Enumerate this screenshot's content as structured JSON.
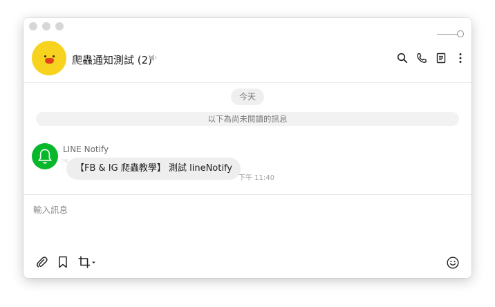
{
  "window": {
    "traffic_lights": [
      "close",
      "minimize",
      "zoom"
    ]
  },
  "header": {
    "chat_title": "爬蟲通知測試 (2)",
    "avatar_icon": "sally-chick-icon",
    "muted_icon": "speaker-icon",
    "actions": [
      {
        "icon": "search-icon"
      },
      {
        "icon": "phone-icon"
      },
      {
        "icon": "notes-icon"
      },
      {
        "icon": "more-vertical-icon"
      }
    ]
  },
  "chat": {
    "date_label": "今天",
    "unread_label": "以下為尚未閱讀的訊息",
    "messages": [
      {
        "sender": "LINE Notify",
        "text": "【FB & IG 爬蟲教學】 測試 lineNotify",
        "time": "下午 11:40",
        "avatar_icon": "bell-icon",
        "avatar_color": "#06b72b"
      }
    ]
  },
  "composer": {
    "placeholder": "輸入訊息",
    "tools": [
      "attach-icon",
      "keep-bookmark-icon",
      "screenshot-crop-icon"
    ],
    "emoji_icon": "emoji-icon"
  }
}
